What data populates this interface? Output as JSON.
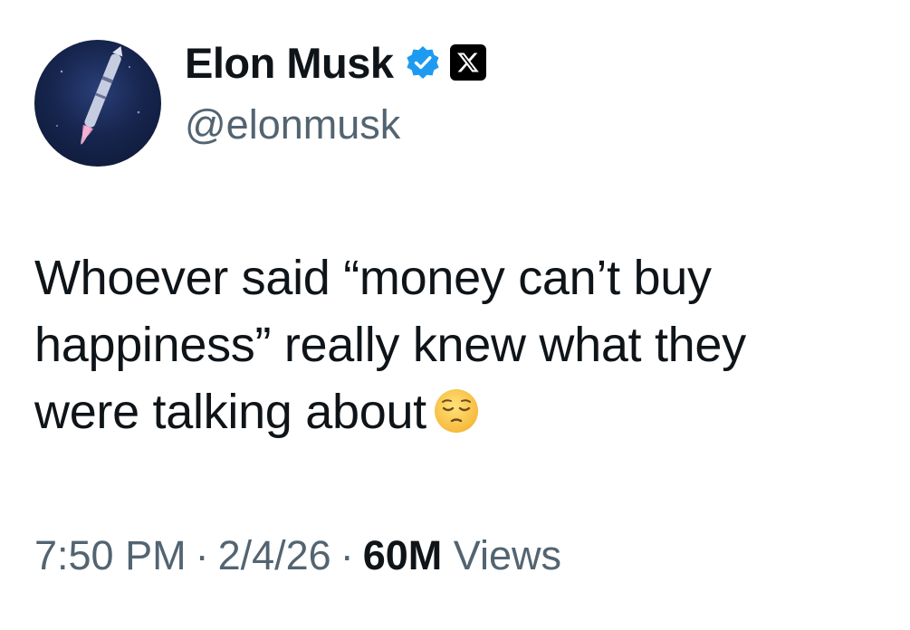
{
  "author": {
    "display_name": "Elon Musk",
    "handle": "@elonmusk",
    "verified_icon": "verified-badge-icon",
    "affiliate_icon": "x-logo-icon",
    "avatar_icon": "rocket-launch-avatar"
  },
  "tweet": {
    "text_line1": "Whoever said “money can’t buy",
    "text_line2": "happiness” really knew what they",
    "text_line3": "were talking about",
    "emoji": "pensive-face-emoji"
  },
  "meta": {
    "time": "7:50 PM",
    "separator": "·",
    "date": "2/4/26",
    "views_count": "60M",
    "views_label": "Views"
  },
  "colors": {
    "text_primary": "#0f1419",
    "text_secondary": "#536471",
    "verified_blue": "#1d9bf0"
  }
}
